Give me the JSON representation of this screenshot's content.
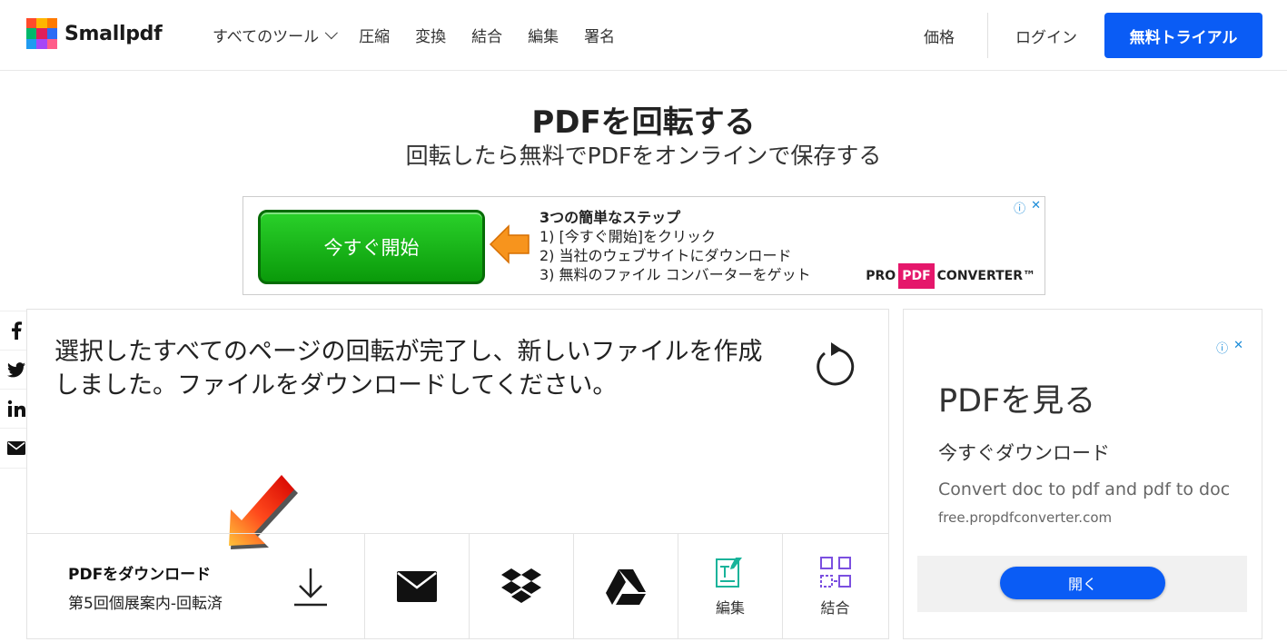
{
  "header": {
    "brand": "Smallpdf",
    "nav": [
      {
        "label": "すべてのツール"
      },
      {
        "label": "圧縮"
      },
      {
        "label": "変換"
      },
      {
        "label": "結合"
      },
      {
        "label": "編集"
      },
      {
        "label": "署名"
      }
    ],
    "price": "価格",
    "login": "ログイン",
    "trial": "無料トライアル",
    "accent_color": "#0a5cf5"
  },
  "page": {
    "title": "PDFを回転する",
    "subtitle": "回転したら無料でPDFをオンラインで保存する"
  },
  "top_ad": {
    "button": "今すぐ開始",
    "heading": "3つの簡単なステップ",
    "steps": [
      "1) [今すぐ開始]をクリック",
      "2) 当社のウェブサイトにダウンロード",
      "3) 無料のファイル コンバーターをゲット"
    ],
    "brand_pro": "PRO",
    "brand_pdf": "PDF",
    "brand_converter": "CONVERTER™",
    "info_icon": "ⓘ",
    "close_icon": "✕"
  },
  "social": [
    "facebook-icon",
    "twitter-icon",
    "linkedin-icon",
    "email-icon"
  ],
  "result": {
    "message": "選択したすべてのページの回転が完了し、新しいファイルを作成しました。ファイルをダウンロードしてください。",
    "download_title": "PDFをダウンロード",
    "file_name": "第5回個展案内-回転済",
    "actions": [
      {
        "name": "email",
        "label": ""
      },
      {
        "name": "dropbox",
        "label": ""
      },
      {
        "name": "google-drive",
        "label": ""
      },
      {
        "name": "edit",
        "label": "編集"
      },
      {
        "name": "merge",
        "label": "結合"
      }
    ]
  },
  "right_ad": {
    "title": "PDFを見る",
    "subtitle": "今すぐダウンロード",
    "description": "Convert doc to pdf and pdf to doc",
    "url": "free.propdfconverter.com",
    "button": "開く",
    "info_icon": "ⓘ",
    "close_icon": "✕"
  }
}
